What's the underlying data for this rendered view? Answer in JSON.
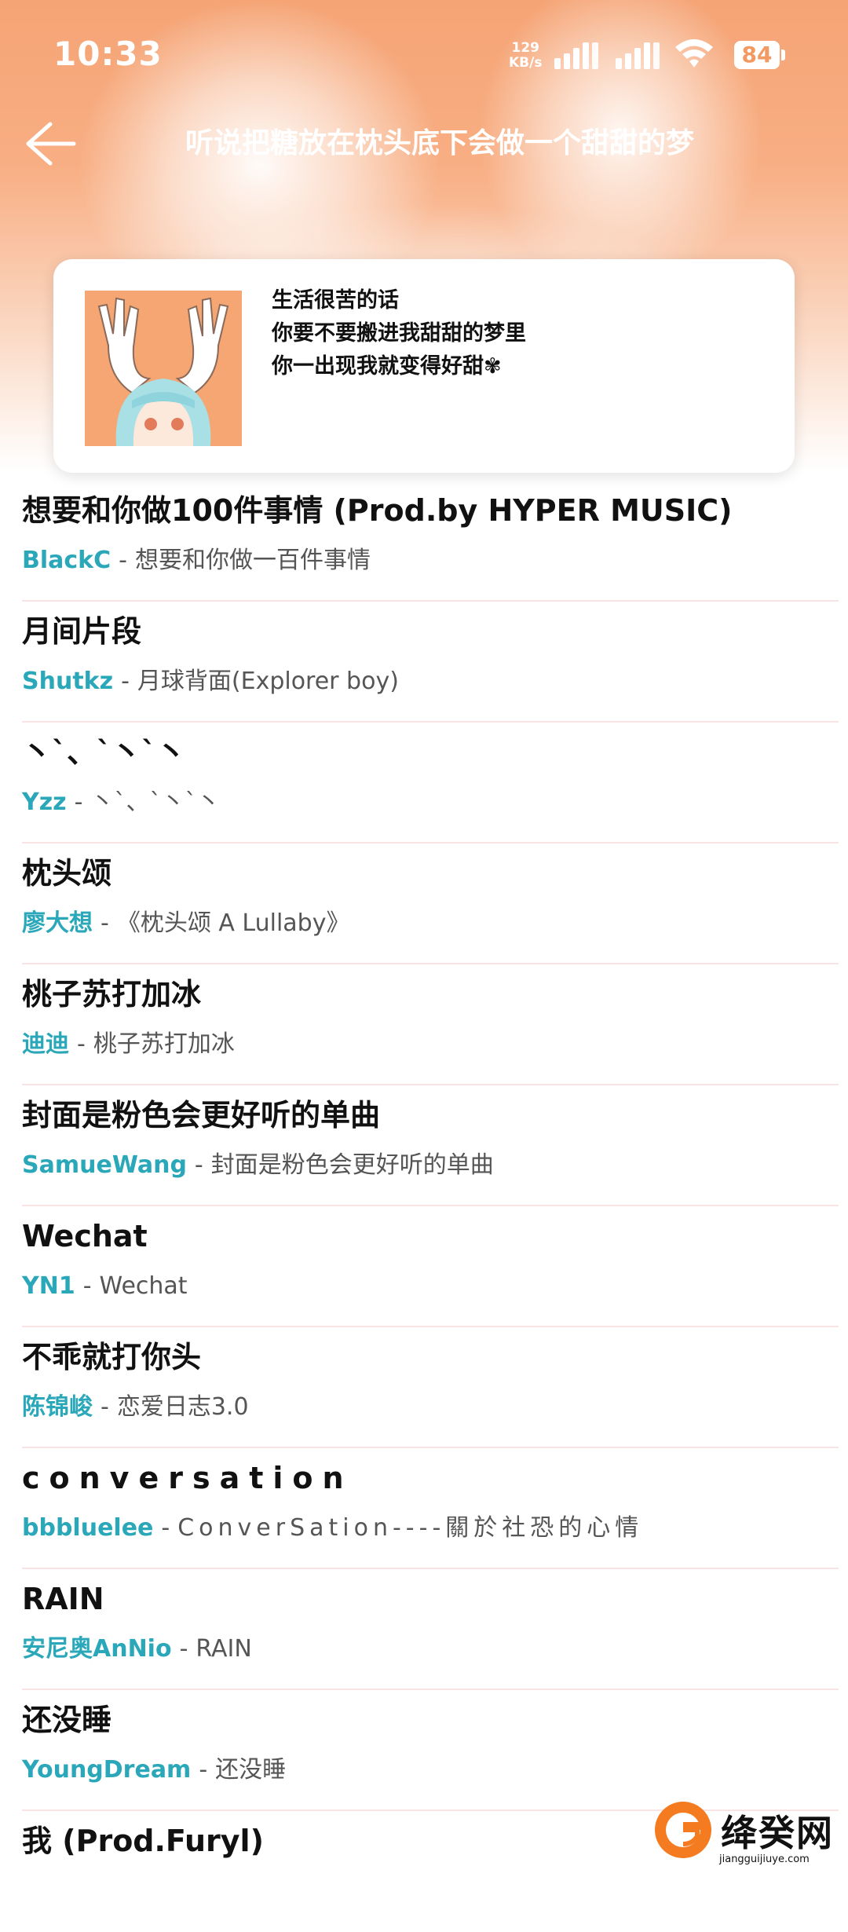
{
  "status_bar": {
    "time": "10:33",
    "net_speed_value": "129",
    "net_speed_unit": "KB/s",
    "battery": "84"
  },
  "header": {
    "title": "听说把糖放在枕头底下会做一个甜甜的梦"
  },
  "intro": {
    "lines": [
      "生活很苦的话",
      "你要不要搬进我甜甜的梦里",
      "你一出现我就变得好甜✾"
    ]
  },
  "songs": [
    {
      "title": "想要和你做100件事情 (Prod.by HYPER MUSIC)",
      "artist": "BlackC",
      "album": "想要和你做一百件事情"
    },
    {
      "title": "月间片段",
      "artist": "Shutkz",
      "album": "月球背面(Explorer boy)"
    },
    {
      "title": "丶ˋ、ˋ丶ˋ丶",
      "artist": "Yzz",
      "album": "丶ˋ、ˋ丶ˋ丶"
    },
    {
      "title": "枕头颂",
      "artist": "廖大想",
      "album": "《枕头颂 A Lullaby》"
    },
    {
      "title": "桃子苏打加冰",
      "artist": "迪迪",
      "album": "桃子苏打加冰"
    },
    {
      "title": "封面是粉色会更好听的单曲",
      "artist": "SamueWang",
      "album": "封面是粉色会更好听的单曲"
    },
    {
      "title": "Wechat",
      "artist": "YN1",
      "album": "Wechat"
    },
    {
      "title": "不乖就打你头",
      "artist": "陈锦峻",
      "album": "恋爱日志3.0"
    },
    {
      "title": "conversation",
      "artist": "bbbluelee",
      "album": "ConverSation----關於社恐的心情"
    },
    {
      "title": "RAIN",
      "artist": "安尼奥AnNio",
      "album": "RAIN"
    },
    {
      "title": "还没睡",
      "artist": "YoungDream",
      "album": "还没睡"
    },
    {
      "title": "我 (Prod.Furyl)",
      "artist": "",
      "album": ""
    }
  ],
  "watermark": {
    "name": "绛癸网",
    "url": "jiangguijiuye.com"
  }
}
